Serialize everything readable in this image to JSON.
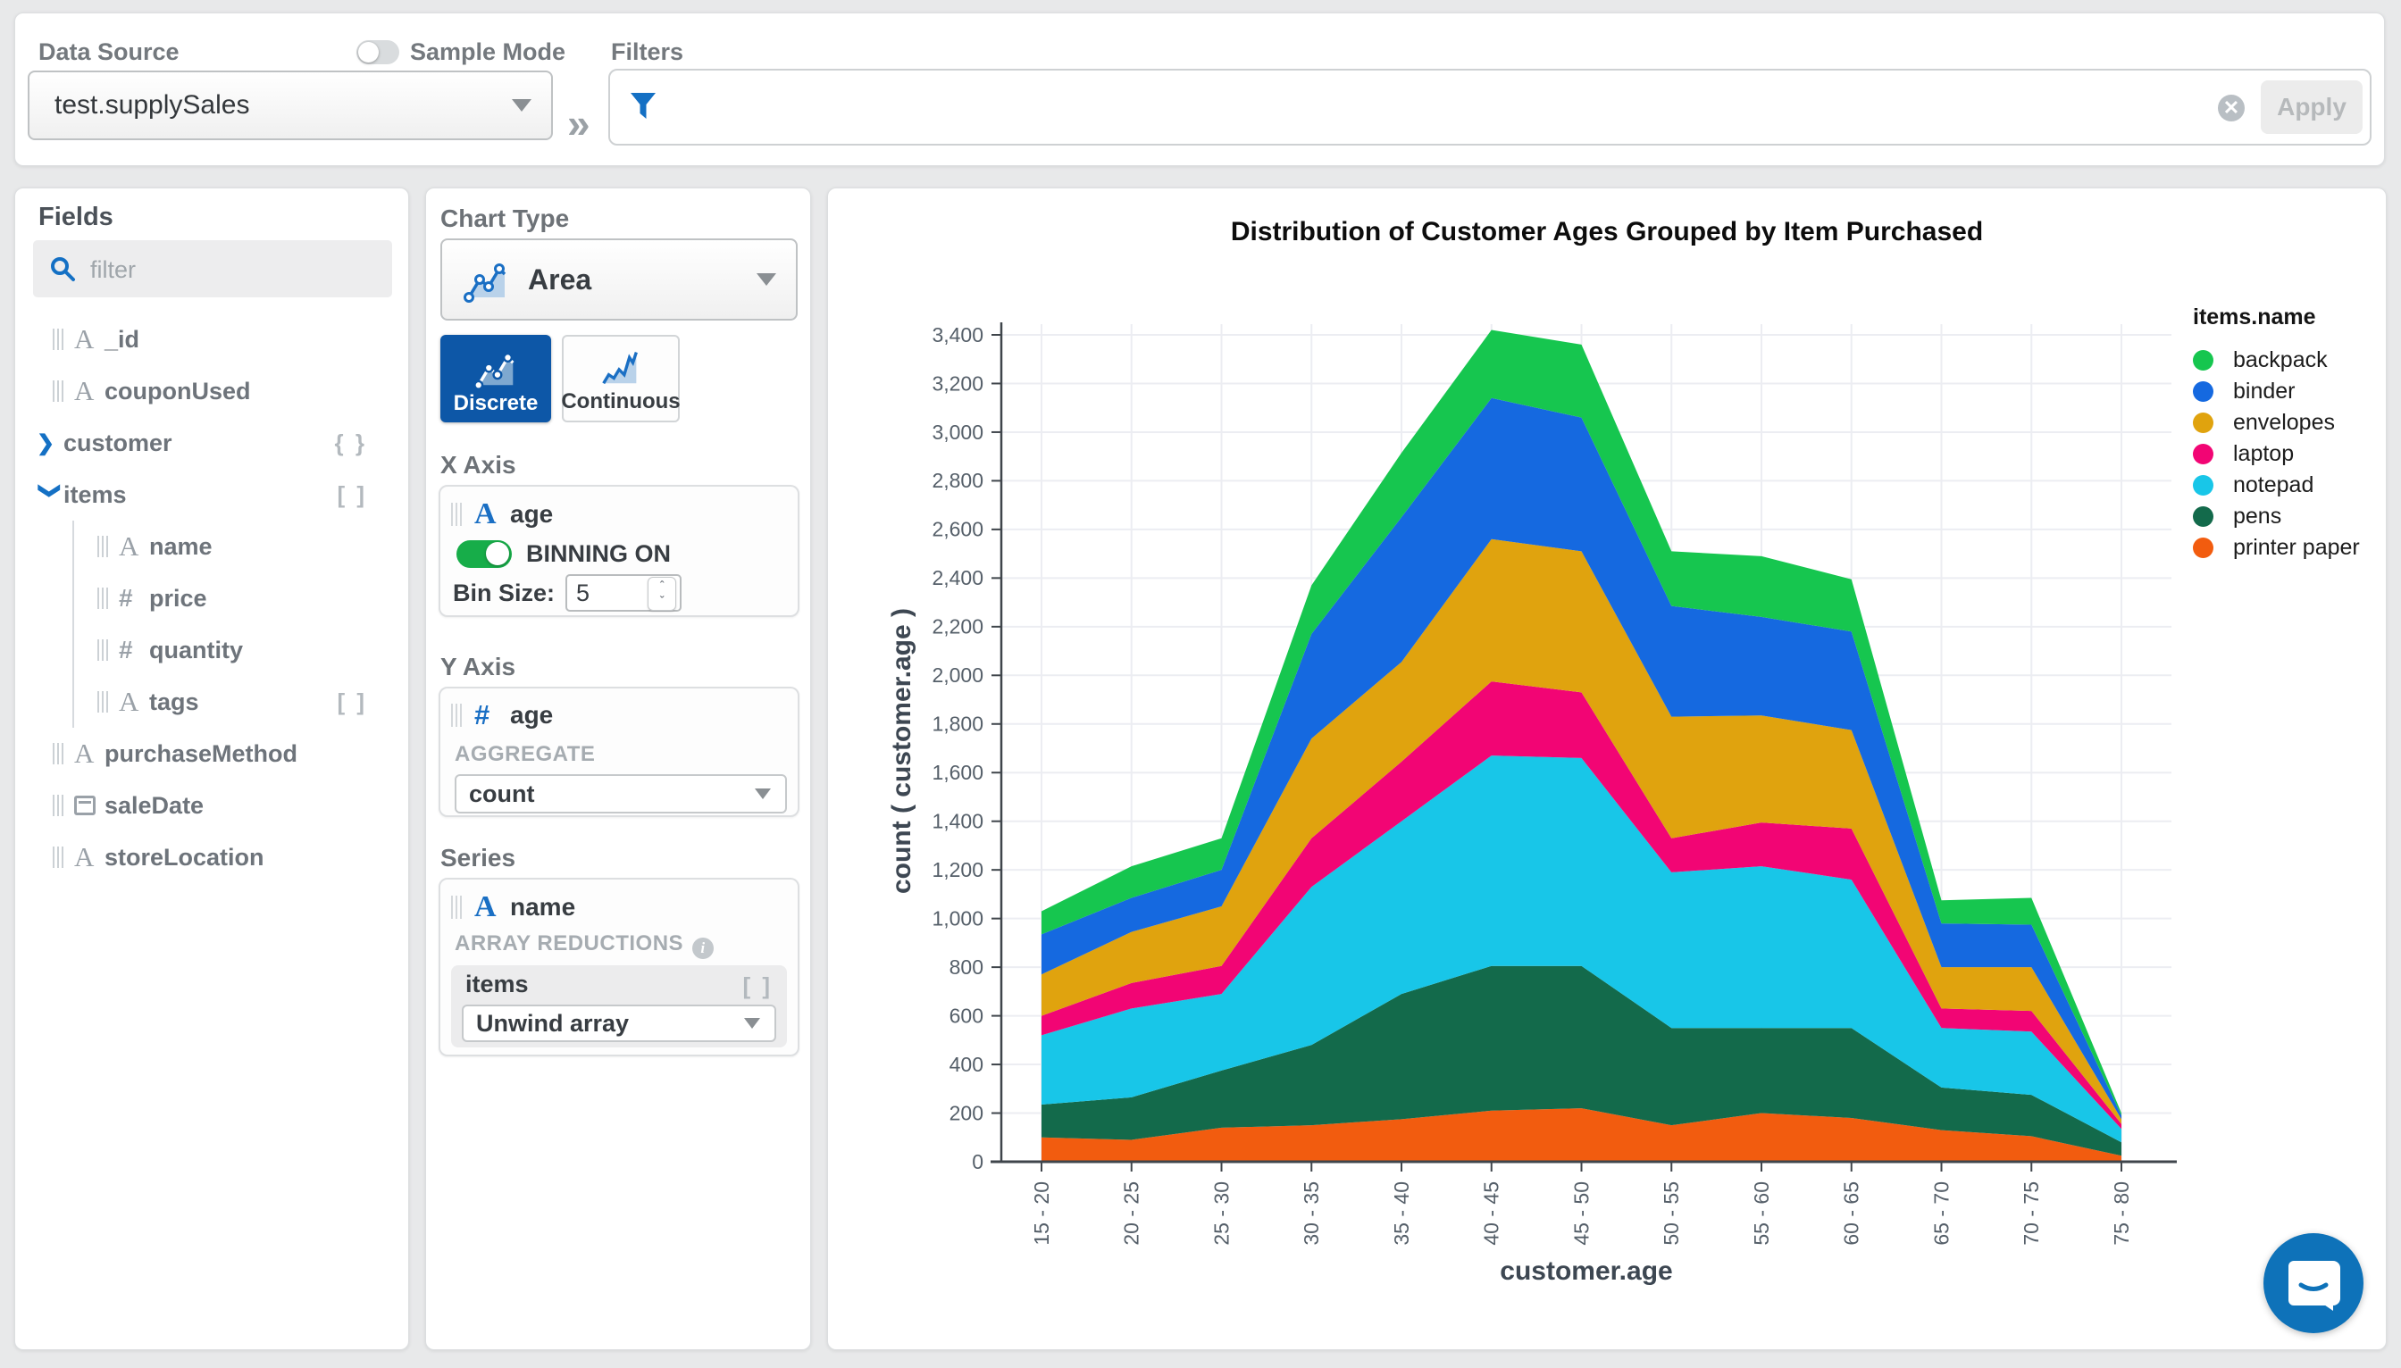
{
  "topbar": {
    "data_source_label": "Data Source",
    "data_source_value": "test.supplySales",
    "sample_mode_label": "Sample Mode",
    "filters_label": "Filters",
    "apply_label": "Apply"
  },
  "fields_panel": {
    "title": "Fields",
    "filter_placeholder": "filter",
    "rows": [
      {
        "name": "_id",
        "type": "string"
      },
      {
        "name": "couponUsed",
        "type": "string"
      },
      {
        "name": "customer",
        "type": "object",
        "badge": "{ }"
      },
      {
        "name": "items",
        "type": "array",
        "badge": "[ ]"
      },
      {
        "name": "name",
        "type": "string"
      },
      {
        "name": "price",
        "type": "number"
      },
      {
        "name": "quantity",
        "type": "number"
      },
      {
        "name": "tags",
        "type": "array",
        "badge": "[ ]"
      },
      {
        "name": "purchaseMethod",
        "type": "string"
      },
      {
        "name": "saleDate",
        "type": "date"
      },
      {
        "name": "storeLocation",
        "type": "string"
      }
    ]
  },
  "encoding_panel": {
    "chart_type_label": "Chart Type",
    "chart_type_value": "Area",
    "discrete_label": "Discrete",
    "continuous_label": "Continuous",
    "x_axis": {
      "section_label": "X Axis",
      "field": "age",
      "binning_label": "BINNING ON",
      "bin_size_label": "Bin Size:",
      "bin_size_value": "5"
    },
    "y_axis": {
      "section_label": "Y Axis",
      "field": "age",
      "aggregate_label": "AGGREGATE",
      "aggregate_value": "count"
    },
    "series": {
      "section_label": "Series",
      "field": "name",
      "reductions_label": "ARRAY REDUCTIONS",
      "array_field": "items",
      "array_badge": "[ ]",
      "reduction_value": "Unwind array"
    }
  },
  "chart_data": {
    "type": "area",
    "stacked": true,
    "stacking": "reverse legend order (printer paper on bottom, backpack on top)",
    "title": "Distribution of Customer Ages Grouped by Item Purchased",
    "xlabel": "customer.age",
    "ylabel": "count ( customer.age )",
    "legend_title": "items.name",
    "legend_position": "right",
    "grid": true,
    "ylim": [
      0,
      3400
    ],
    "ytick_step": 200,
    "categories": [
      "15 - 20",
      "20 - 25",
      "25 - 30",
      "30 - 35",
      "35 - 40",
      "40 - 45",
      "45 - 50",
      "50 - 55",
      "55 - 60",
      "60 - 65",
      "65 - 70",
      "70 - 75",
      "75 - 80"
    ],
    "series": [
      {
        "name": "backpack",
        "color": "#16C64F",
        "values": [
          95,
          130,
          130,
          200,
          265,
          280,
          300,
          225,
          250,
          215,
          95,
          110,
          10
        ]
      },
      {
        "name": "binder",
        "color": "#1569E0",
        "values": [
          165,
          140,
          150,
          430,
          595,
          580,
          550,
          455,
          405,
          405,
          180,
          175,
          15
        ]
      },
      {
        "name": "envelopes",
        "color": "#E0A30E",
        "values": [
          170,
          210,
          245,
          410,
          410,
          585,
          580,
          500,
          440,
          405,
          170,
          180,
          20
        ]
      },
      {
        "name": "laptop",
        "color": "#F20574",
        "values": [
          80,
          105,
          115,
          200,
          245,
          305,
          270,
          140,
          180,
          210,
          80,
          85,
          20
        ]
      },
      {
        "name": "notepad",
        "color": "#18C6E8",
        "values": [
          285,
          365,
          315,
          650,
          710,
          865,
          855,
          640,
          665,
          610,
          245,
          260,
          55
        ]
      },
      {
        "name": "pens",
        "color": "#136A4B",
        "values": [
          135,
          175,
          235,
          330,
          515,
          595,
          585,
          400,
          350,
          370,
          175,
          170,
          55
        ]
      },
      {
        "name": "printer paper",
        "color": "#F25C0F",
        "values": [
          100,
          90,
          140,
          150,
          175,
          210,
          220,
          150,
          200,
          180,
          130,
          105,
          25
        ]
      }
    ],
    "totals": [
      1030,
      1215,
      1330,
      2370,
      2915,
      3420,
      3360,
      2510,
      2490,
      2395,
      1075,
      1085,
      200
    ]
  },
  "colors": {
    "accent_blue": "#1470c4",
    "selected_button_blue": "#0d57a7",
    "toggle_green": "#17ad49",
    "page_background": "#e8e9ea"
  }
}
